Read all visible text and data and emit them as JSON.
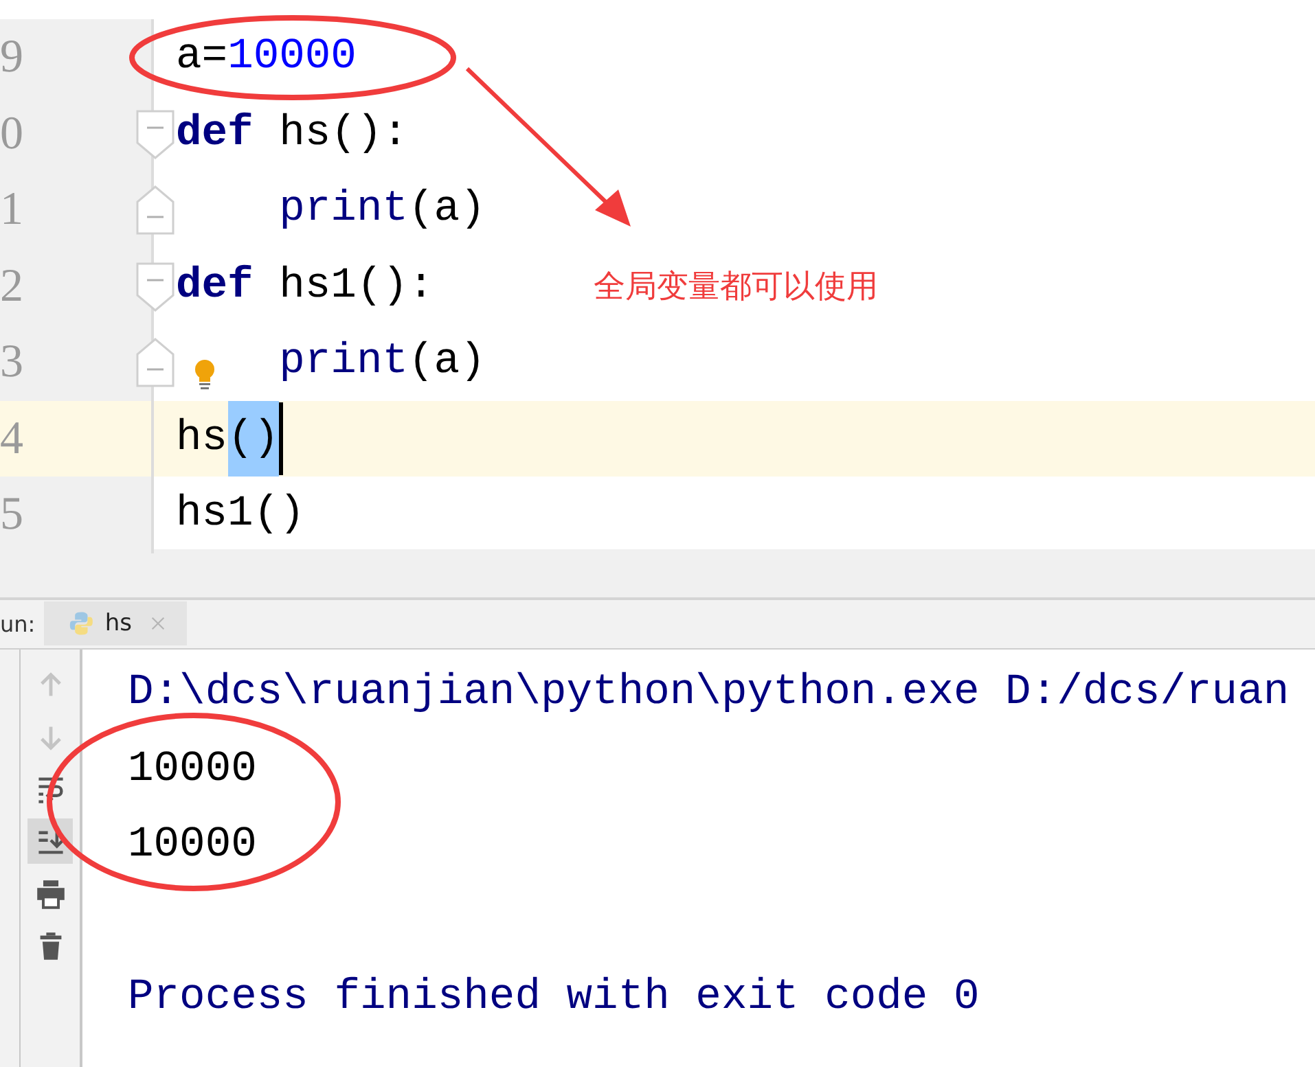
{
  "editor": {
    "lines": [
      {
        "number": "9",
        "selected": false,
        "caret": false,
        "bulb": false,
        "tokens": [
          {
            "kind": "plain",
            "text": "a="
          },
          {
            "kind": "number",
            "text": "10000"
          }
        ]
      },
      {
        "number": "0",
        "selected": false,
        "caret": false,
        "bulb": false,
        "tokens": [
          {
            "kind": "keyword",
            "text": "def"
          },
          {
            "kind": "plain",
            "text": " hs():"
          }
        ],
        "children": [
          {
            "number": "1",
            "selected": false,
            "caret": false,
            "bulb": false,
            "tokens": [
              {
                "kind": "builtin",
                "text": "print"
              },
              {
                "kind": "plain",
                "text": "(a)"
              }
            ]
          }
        ]
      },
      {
        "number": "2",
        "selected": false,
        "caret": false,
        "bulb": false,
        "tokens": [
          {
            "kind": "keyword",
            "text": "def"
          },
          {
            "kind": "plain",
            "text": " hs1():"
          }
        ],
        "children": [
          {
            "number": "3",
            "selected": false,
            "caret": false,
            "bulb": true,
            "tokens": [
              {
                "kind": "builtin",
                "text": "print"
              },
              {
                "kind": "plain",
                "text": "(a)"
              }
            ]
          }
        ]
      },
      {
        "number": "4",
        "selected": true,
        "caret": true,
        "bulb": false,
        "tokens": [
          {
            "kind": "plain",
            "text": "hs"
          },
          {
            "kind": "highlight",
            "text": "()"
          }
        ]
      },
      {
        "number": "5",
        "selected": false,
        "caret": false,
        "bulb": false,
        "tokens": [
          {
            "kind": "plain",
            "text": "hs1()"
          }
        ]
      }
    ]
  },
  "annotation": {
    "note": "全局变量都可以使用"
  },
  "run_panel": {
    "label": "un:",
    "tabs": [
      {
        "label": "hs",
        "selected": true
      }
    ],
    "tools": [
      {
        "kind": "up",
        "selected": false
      },
      {
        "kind": "down",
        "selected": false
      },
      {
        "kind": "wrap",
        "selected": false
      },
      {
        "kind": "scroll",
        "selected": true
      },
      {
        "kind": "print",
        "selected": false
      },
      {
        "kind": "trash",
        "selected": false
      }
    ],
    "console": [
      {
        "kind": "command",
        "text": "D:\\dcs\\ruanjian\\python\\python.exe D:/dcs/ruan"
      },
      {
        "kind": "output",
        "text": "10000"
      },
      {
        "kind": "output",
        "text": "10000"
      },
      {
        "kind": "blank"
      },
      {
        "kind": "status",
        "text": "Process finished with exit code 0"
      }
    ]
  }
}
